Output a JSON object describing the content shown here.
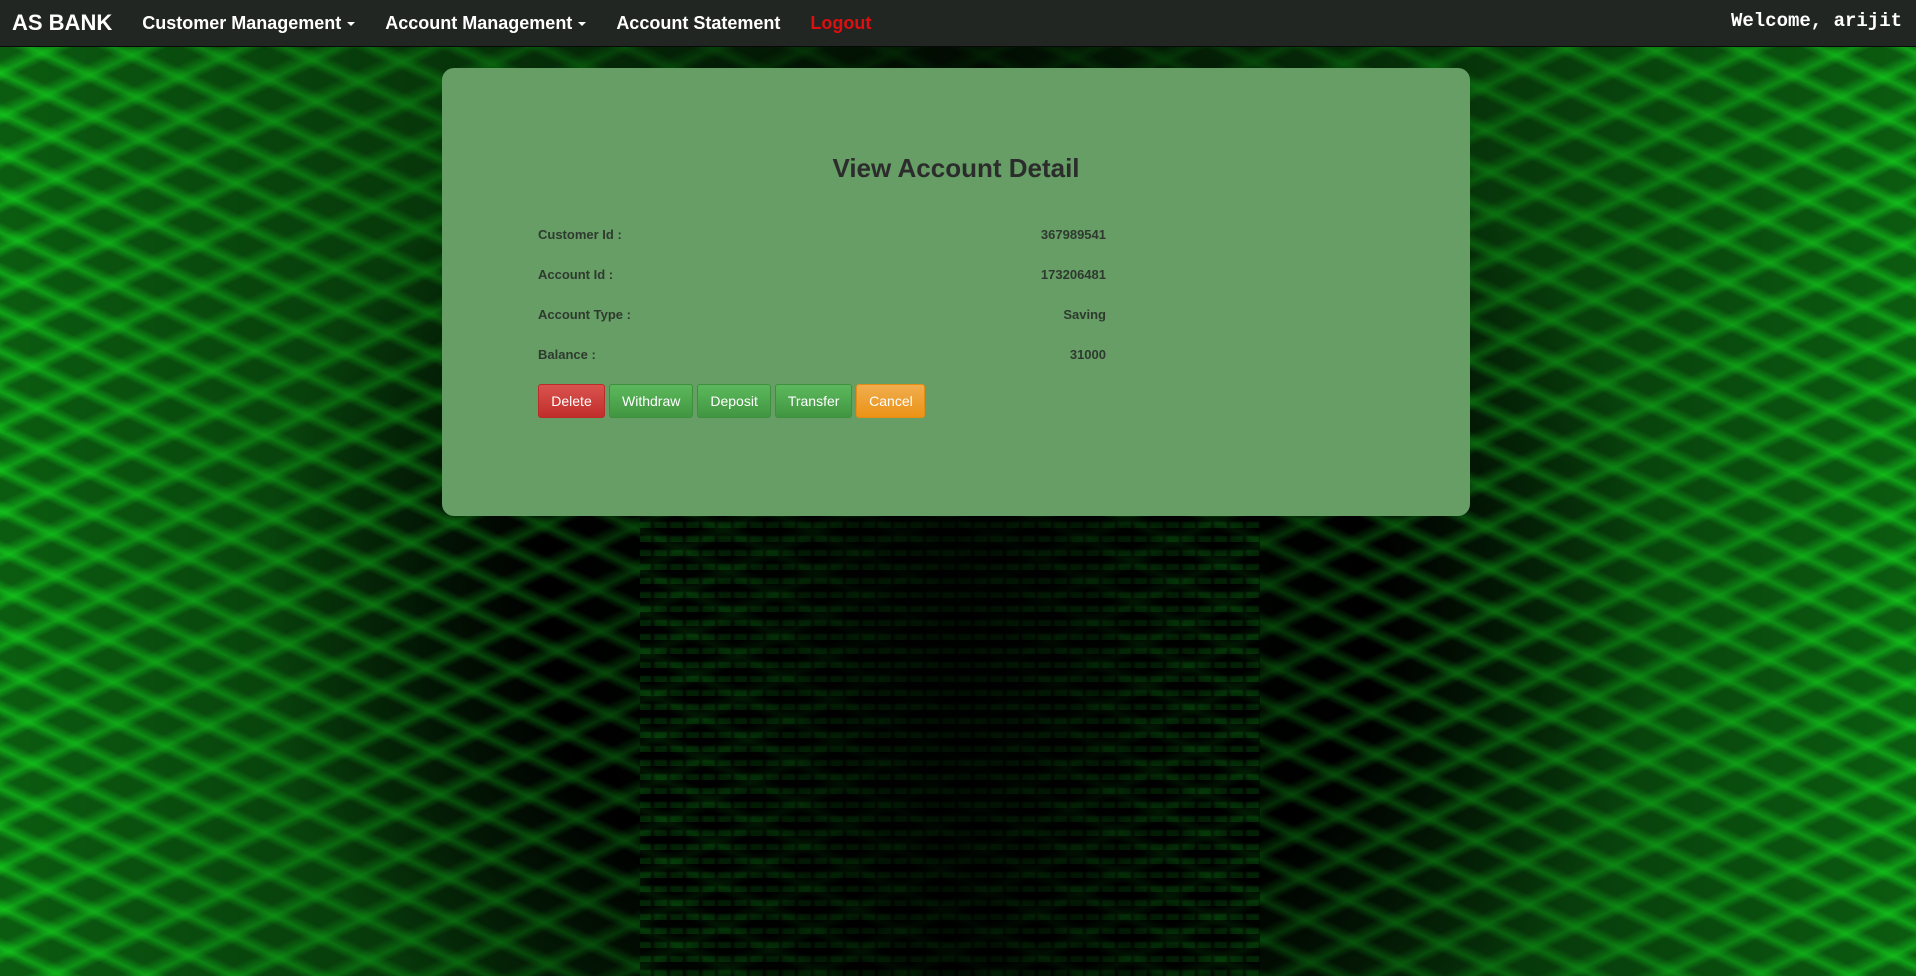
{
  "navbar": {
    "brand": "AS BANK",
    "items": [
      {
        "label": "Customer Management",
        "dropdown": true
      },
      {
        "label": "Account Management",
        "dropdown": true
      },
      {
        "label": "Account Statement",
        "dropdown": false
      }
    ],
    "logout": "Logout",
    "welcome": "Welcome, arijit"
  },
  "panel": {
    "title": "View Account Detail",
    "fields": [
      {
        "label": "Customer Id :",
        "value": "367989541"
      },
      {
        "label": "Account Id :",
        "value": "173206481"
      },
      {
        "label": "Account Type :",
        "value": "Saving"
      },
      {
        "label": "Balance :",
        "value": "31000"
      }
    ],
    "buttons": {
      "delete": "Delete",
      "withdraw": "Withdraw",
      "deposit": "Deposit",
      "transfer": "Transfer",
      "cancel": "Cancel"
    }
  },
  "colors": {
    "navbar_bg": "#222623",
    "panel_bg": "#669e66",
    "logout": "#e00e0e",
    "danger": "#d9534f",
    "success": "#5cb85c",
    "warning": "#f0ad4e"
  }
}
